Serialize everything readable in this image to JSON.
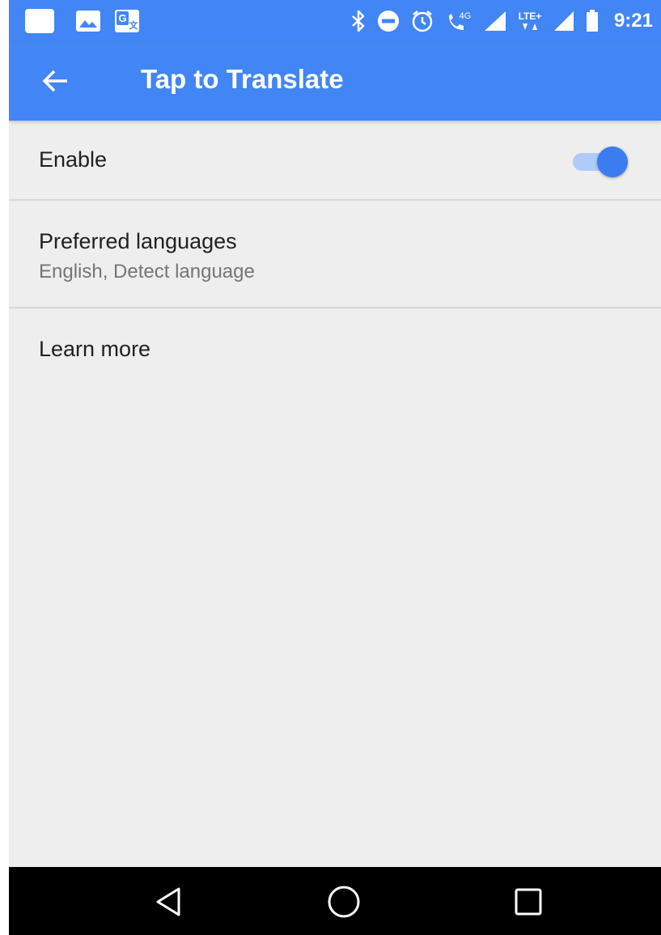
{
  "status_bar": {
    "time": "9:21",
    "network_4g_label": "4G",
    "lte_label": "LTE+",
    "left_icons": [
      "notification-square-icon",
      "image-icon",
      "google-translate-icon"
    ],
    "right_icons": [
      "bluetooth-icon",
      "do-not-disturb-icon",
      "alarm-icon",
      "wifi-calling-icon",
      "signal-icon",
      "lte-data-icon",
      "signal-icon",
      "battery-icon"
    ]
  },
  "app_bar": {
    "title": "Tap to Translate",
    "back_icon": "arrow-left-icon",
    "color": "#4285f4"
  },
  "settings": {
    "enable": {
      "label": "Enable",
      "checked": true
    },
    "preferred_languages": {
      "label": "Preferred languages",
      "summary": "English, Detect language"
    },
    "learn_more": {
      "label": "Learn more"
    }
  },
  "nav_bar": {
    "buttons": [
      "back-triangle-icon",
      "home-circle-icon",
      "recents-square-icon"
    ]
  },
  "colors": {
    "accent": "#4285f4",
    "toggle_thumb": "#3b7cf0",
    "toggle_track": "#aecbfa",
    "background": "#eeeeee"
  }
}
